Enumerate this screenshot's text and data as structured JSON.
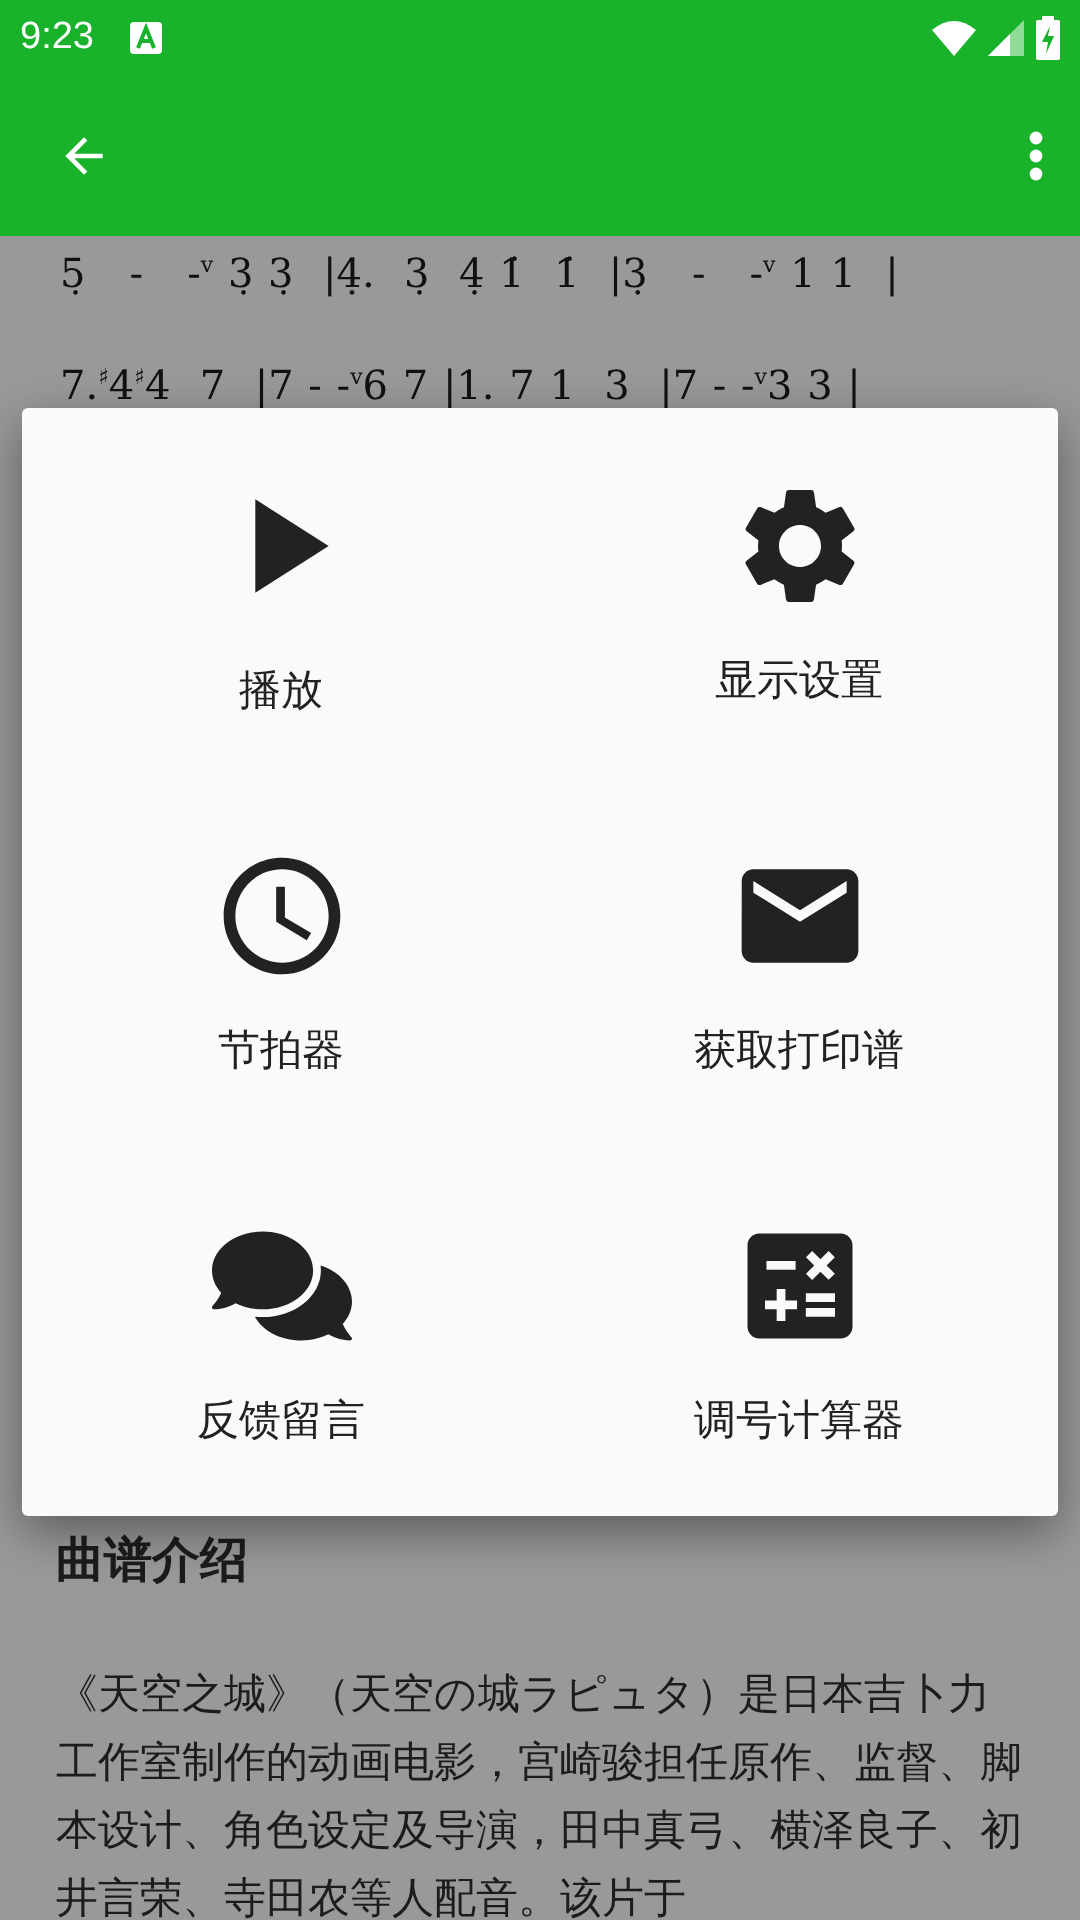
{
  "status_bar": {
    "time": "9:23"
  },
  "score": {
    "lines": [
      "5̣   -   -$^{v}$ 3̣ 3̣  |4̣.  3̣  4̣ 1̇  1̇  |3̣   -   -$^{v}$ 1 1  |",
      "7.$^{♯}$4$^{♯}$4  7  |7 - -$^{v}$6 7 |1. 7 1  3  |7 - -$^{v}$3 3 |"
    ]
  },
  "menu": {
    "items": [
      {
        "label": "播放",
        "kind": "play"
      },
      {
        "label": "显示设置",
        "kind": "settings"
      },
      {
        "label": "节拍器",
        "kind": "clock"
      },
      {
        "label": "获取打印谱",
        "kind": "mail"
      },
      {
        "label": "反馈留言",
        "kind": "chat"
      },
      {
        "label": "调号计算器",
        "kind": "calculator"
      }
    ]
  },
  "intro": {
    "heading": "曲谱介绍",
    "text": "《天空之城》（天空の城ラピュタ）是日本吉卜力工作室制作的动画电影，宫崎骏担任原作、监督、脚本设计、角色设定及导演，田中真弓、横泽良子、初井言荣、寺田农等人配音。该片于"
  }
}
